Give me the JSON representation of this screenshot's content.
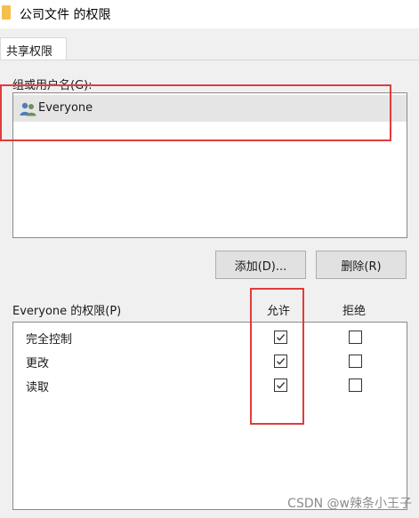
{
  "window": {
    "title": "公司文件 的权限",
    "folder_icon": "folder-icon"
  },
  "tabs": [
    {
      "label": "共享权限",
      "selected": true
    }
  ],
  "groups_section": {
    "label": "组或用户名(G):",
    "items": [
      {
        "label": "Everyone",
        "icon": "users-icon",
        "selected": true
      }
    ]
  },
  "buttons": {
    "add_label": "添加(D)...",
    "remove_label": "删除(R)"
  },
  "permissions": {
    "header_label": "Everyone 的权限(P)",
    "allow_label": "允许",
    "deny_label": "拒绝",
    "rows": [
      {
        "name": "完全控制",
        "allow": true,
        "deny": false
      },
      {
        "name": "更改",
        "allow": true,
        "deny": false
      },
      {
        "name": "读取",
        "allow": true,
        "deny": false
      }
    ]
  },
  "watermark": "CSDN @w辣条小王子",
  "colors": {
    "highlight": "#e23b3b",
    "panel_background": "#f0f0f0",
    "selection": "#e5e5e5",
    "folder": "#f4c04b"
  }
}
